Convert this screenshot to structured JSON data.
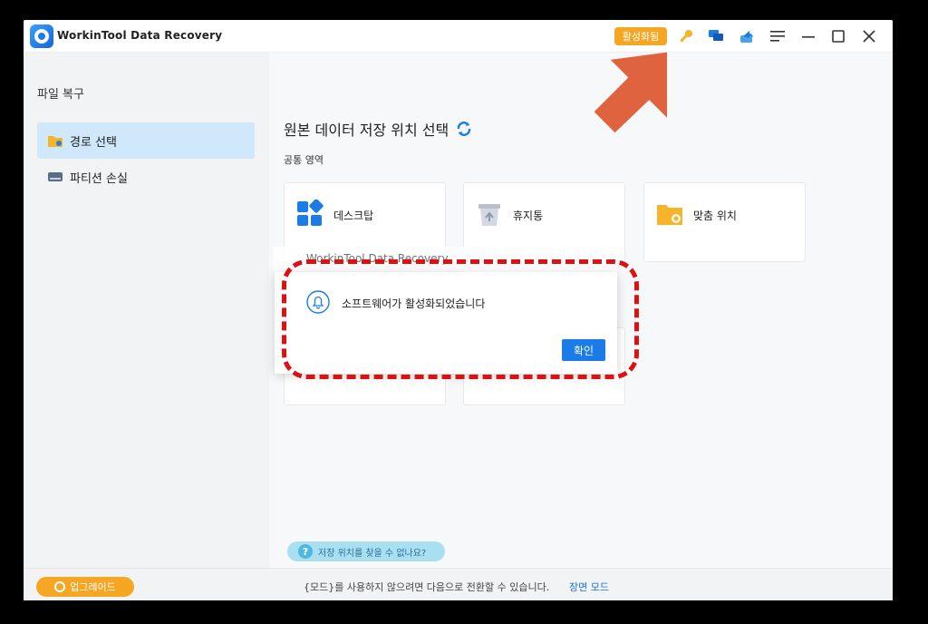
{
  "app": {
    "title": "WorkinTool Data Recovery",
    "activated_badge": "활성화됨"
  },
  "toolbar_icons": [
    "key-icon",
    "chat-icon",
    "share-icon",
    "menu-icon",
    "minimize-icon",
    "maximize-icon",
    "close-icon"
  ],
  "sidebar": {
    "heading": "파일 복구",
    "items": [
      {
        "label": "경로 선택",
        "icon": "folder-icon",
        "active": true
      },
      {
        "label": "파티션 손실",
        "icon": "drive-icon",
        "active": false
      }
    ]
  },
  "main": {
    "title": "원본 데이터 저장 위치 선택",
    "common_section": "공통 영역",
    "cards": [
      {
        "label": "데스크탑",
        "icon": "desktop-icon"
      },
      {
        "label": "휴지통",
        "icon": "recycle-bin-icon"
      },
      {
        "label": "맞춤 위치",
        "icon": "custom-folder-icon"
      }
    ],
    "partial_label": "WorkinTool Data Recovery"
  },
  "dialog": {
    "message": "소프트웨어가 활성화되었습니다",
    "ok_label": "확인"
  },
  "help": {
    "label": "저장 위치를 찾을 수 없나요?",
    "icon_glyph": "?"
  },
  "bottom": {
    "upgrade_label": "업그레이드",
    "mode_text": "{모드}를 사용하지 않으려면 다음으로 전환할 수 있습니다.",
    "mode_link": "장면 모드"
  },
  "colors": {
    "accent": "#1b7ce8",
    "orange": "#f5a623",
    "annotation_red": "#d11111",
    "arrow": "#e0633f"
  }
}
